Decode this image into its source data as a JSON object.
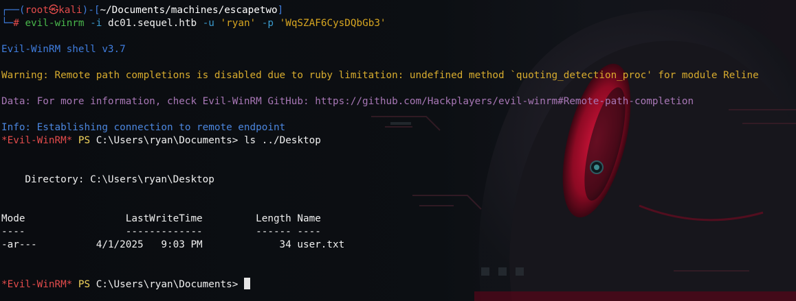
{
  "theme": {
    "background": "#0b0d10",
    "prompt_frame_color": "#3f7dde",
    "prompt_user_color": "#e24b4b",
    "command_color": "#49b84b",
    "string_color": "#d7a520",
    "warning_color": "#d8ac2e",
    "data_color": "#a877b6",
    "info_color": "#4b86de",
    "evilwinrm_prompt_color": "#e24b4b",
    "ps_color": "#f2d45c",
    "art_accent_color": "#c4002a"
  },
  "prompt": {
    "corner_top": "┌──(",
    "user": "root㉿kali",
    "sep": ")-[",
    "cwd": "~/Documents/machines/escapetwo",
    "close": "]",
    "corner_bottom": "└─",
    "hash": "#"
  },
  "command": {
    "exe": "evil-winrm",
    "flag_i": "-i",
    "host": "dc01.sequel.htb",
    "flag_u": "-u",
    "user": "'ryan'",
    "flag_p": "-p",
    "password": "'WqSZAF6CysDQbGb3'"
  },
  "output": {
    "shell_banner": "Evil-WinRM shell v3.7",
    "warning": "Warning: Remote path completions is disabled due to ruby limitation: undefined method `quoting_detection_proc' for module Reline",
    "data": "Data: For more information, check Evil-WinRM GitHub: https://github.com/Hackplayers/evil-winrm#Remote-path-completion",
    "info": "Info: Establishing connection to remote endpoint"
  },
  "session": {
    "prompt_tag": "*Evil-WinRM*",
    "ps": "PS",
    "path": "C:\\Users\\ryan\\Documents>",
    "command1": "ls ../Desktop"
  },
  "listing": {
    "directory_label": "    Directory: C:\\Users\\ryan\\Desktop",
    "header": "Mode                 LastWriteTime         Length Name",
    "underline": "----                 -------------         ------ ----",
    "rows": [
      {
        "text": "-ar---          4/1/2025   9:03 PM             34 user.txt"
      }
    ]
  }
}
